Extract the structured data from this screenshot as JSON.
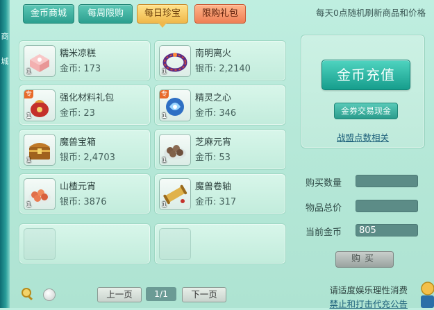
{
  "tabs": [
    {
      "label": "金币商城"
    },
    {
      "label": "每周限购"
    },
    {
      "label": "每日珍宝"
    },
    {
      "label": "限购礼包"
    }
  ],
  "notice": "每天0点随机刷新商品和价格",
  "left_edge_chars": [
    "商",
    "城"
  ],
  "items": [
    {
      "name": "糯米凉糕",
      "currency": "金币:",
      "price": "173",
      "qty": "1",
      "tag": "",
      "icon": "rice-cake-icon"
    },
    {
      "name": "南明离火",
      "currency": "银币:",
      "price": "2,2140",
      "qty": "1",
      "tag": "",
      "icon": "fire-ring-icon"
    },
    {
      "name": "强化材料礼包",
      "currency": "金币:",
      "price": "23",
      "qty": "1",
      "tag": "专",
      "icon": "material-bag-icon"
    },
    {
      "name": "精灵之心",
      "currency": "金币:",
      "price": "346",
      "qty": "1",
      "tag": "专",
      "icon": "spirit-heart-icon"
    },
    {
      "name": "魔兽宝箱",
      "currency": "银币:",
      "price": "2,4703",
      "qty": "1",
      "tag": "",
      "icon": "treasure-chest-icon"
    },
    {
      "name": "芝麻元宵",
      "currency": "金币:",
      "price": "53",
      "qty": "1",
      "tag": "",
      "icon": "sesame-dumpling-icon"
    },
    {
      "name": "山楂元宵",
      "currency": "银币:",
      "price": "3876",
      "qty": "1",
      "tag": "",
      "icon": "hawthorn-dumpling-icon"
    },
    {
      "name": "魔兽卷轴",
      "currency": "金币:",
      "price": "317",
      "qty": "1",
      "tag": "",
      "icon": "scroll-icon"
    }
  ],
  "panel": {
    "recharge": "金币充值",
    "voucher": "金券交易现金",
    "alliance": "战盟点数相关"
  },
  "purchase": {
    "qty_label": "购买数量",
    "qty_value": "",
    "total_label": "物品总价",
    "total_value": "",
    "gold_label": "当前金币",
    "gold_value": "805",
    "buy_label": "购买"
  },
  "pager": {
    "prev": "上一页",
    "page": "1/1",
    "next": "下一页"
  },
  "footer": {
    "line1": "请适度娱乐理性消费",
    "line2": "禁止和打击代充公告"
  },
  "colors": {
    "accent": "#2c9f8f",
    "active_tab": "#f0b84a",
    "promo_tab": "#ef7f55"
  }
}
